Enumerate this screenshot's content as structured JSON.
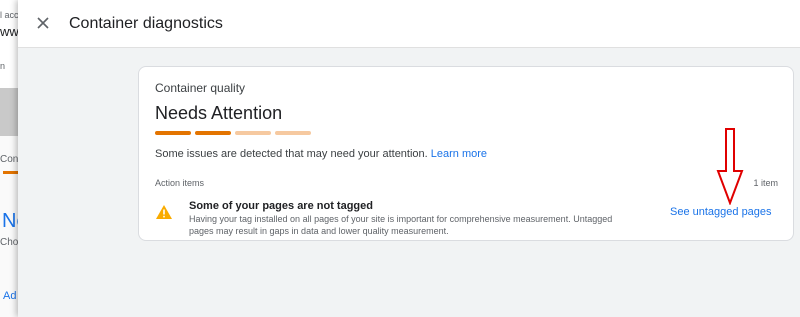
{
  "background": {
    "frag1": "l acc",
    "frag2": "ww",
    "frag3": "n",
    "tab_fragment": "Con",
    "heading_fragment": "Ne",
    "sub_fragment": "Cho",
    "link_fragment": "Ad",
    "accent_color": "#e37400"
  },
  "panel": {
    "title": "Container diagnostics",
    "close_icon": "close-icon"
  },
  "card": {
    "subtitle": "Container quality",
    "status": "Needs Attention",
    "quality_level": {
      "filled": 2,
      "total": 4
    },
    "quality_colors": {
      "filled": "#e37400",
      "empty": "#f6c9a0"
    },
    "description": "Some issues are detected that may need your attention.",
    "learn_more": "Learn more",
    "action_items_label": "Action items",
    "item_count": "1 item",
    "issue": {
      "icon": "warning-icon",
      "icon_color": "#f9ab00",
      "title": "Some of your pages are not tagged",
      "description": "Having your tag installed on all pages of your site is important for comprehensive measurement. Untagged pages may result in gaps in data and lower quality measurement.",
      "action": "See untagged pages"
    }
  },
  "annotation": {
    "icon": "red-arrow-icon",
    "color": "#e00000"
  },
  "colors": {
    "link": "#1a73e8",
    "panel_bg": "#f1f3f4"
  }
}
